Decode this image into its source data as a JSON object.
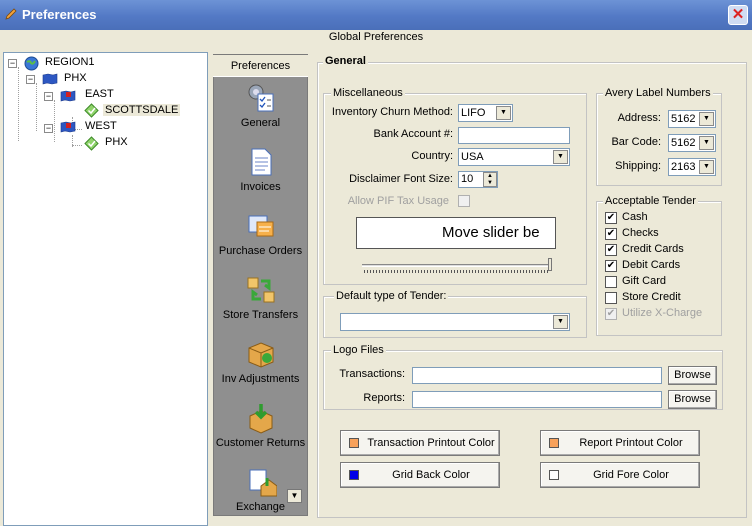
{
  "window": {
    "title": "Preferences",
    "close": "✕"
  },
  "header": {
    "title": "Global Preferences"
  },
  "tree": {
    "nodes": [
      {
        "label": "REGION1",
        "expander": "−"
      },
      {
        "label": "PHX",
        "expander": "−"
      },
      {
        "label": "EAST",
        "expander": "−"
      },
      {
        "label": "SCOTTSDALE",
        "selected": true
      },
      {
        "label": "WEST",
        "expander": "−"
      },
      {
        "label": "PHX"
      }
    ]
  },
  "nav": {
    "header": "Preferences",
    "items": [
      {
        "label": "General",
        "icon": "settings-checklist-icon"
      },
      {
        "label": "Invoices",
        "icon": "document-icon"
      },
      {
        "label": "Purchase Orders",
        "icon": "purchase-orders-icon"
      },
      {
        "label": "Store Transfers",
        "icon": "transfer-arrows-icon"
      },
      {
        "label": "Inv Adjustments",
        "icon": "box-adjust-icon"
      },
      {
        "label": "Customer Returns",
        "icon": "return-arrow-icon"
      },
      {
        "label": "Exchange",
        "icon": "exchange-icon"
      }
    ],
    "scroll_arrow": "▼"
  },
  "general": {
    "title": "General",
    "misc": {
      "title": "Miscellaneous",
      "churn_label": "Inventory Churn Method:",
      "churn_value": "LIFO",
      "bank_label": "Bank Account #:",
      "bank_value": "",
      "country_label": "Country:",
      "country_value": "USA",
      "font_label": "Disclaimer Font Size:",
      "font_value": "10",
      "pif_label": "Allow PIF Tax Usage",
      "marquee_text": "Move slider be",
      "slider_value": 1.0
    },
    "tender_default": {
      "title": "Default type of Tender:",
      "value": ""
    },
    "avery": {
      "title": "Avery Label Numbers",
      "address_label": "Address:",
      "address_value": "5162",
      "barcode_label": "Bar Code:",
      "barcode_value": "5162",
      "shipping_label": "Shipping:",
      "shipping_value": "2163"
    },
    "acceptable_tender": {
      "title": "Acceptable Tender",
      "items": [
        {
          "label": "Cash",
          "checked": true
        },
        {
          "label": "Checks",
          "checked": true
        },
        {
          "label": "Credit Cards",
          "checked": true
        },
        {
          "label": "Debit Cards",
          "checked": true
        },
        {
          "label": "Gift Card",
          "checked": false
        },
        {
          "label": "Store Credit",
          "checked": false
        },
        {
          "label": "Utilize X-Charge",
          "checked": true,
          "disabled": true
        }
      ]
    },
    "logo_files": {
      "title": "Logo Files",
      "transactions_label": "Transactions:",
      "transactions_value": "",
      "reports_label": "Reports:",
      "reports_value": "",
      "browse": "Browse"
    },
    "color_buttons": {
      "transaction": {
        "label": "Transaction Printout Color",
        "color": "#f7a15a"
      },
      "report": {
        "label": "Report Printout Color",
        "color": "#f7a15a"
      },
      "grid_back": {
        "label": "Grid Back Color",
        "color": "#0000e6"
      },
      "grid_fore": {
        "label": "Grid Fore Color",
        "color": "#ffffff"
      }
    }
  }
}
